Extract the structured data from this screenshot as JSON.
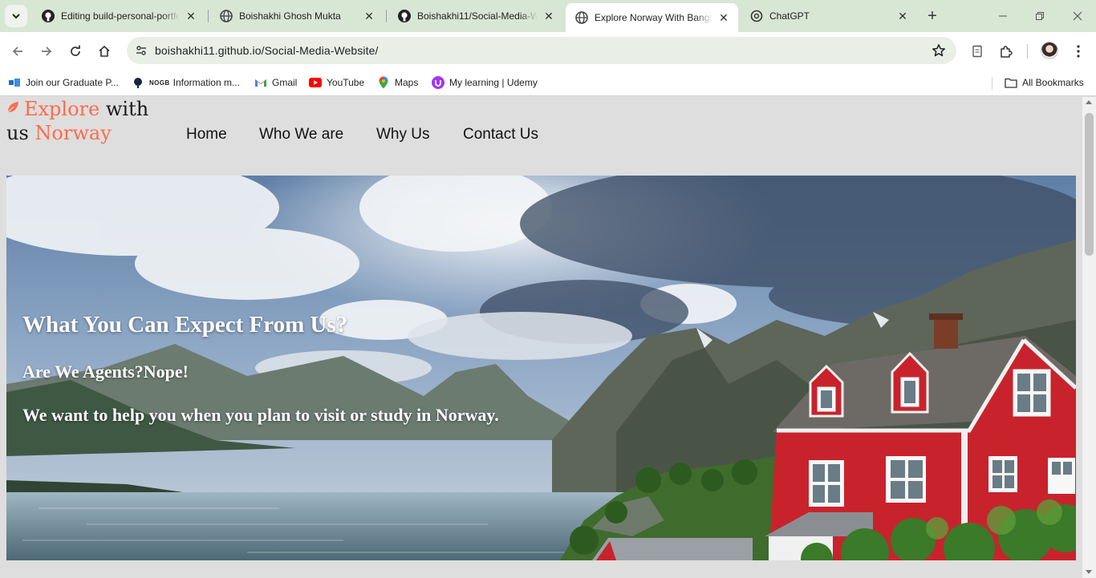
{
  "browser": {
    "tabs": [
      {
        "title": "Editing build-personal-portfolio",
        "icon": "github-icon"
      },
      {
        "title": "Boishakhi Ghosh Mukta",
        "icon": "globe-icon"
      },
      {
        "title": "Boishakhi11/Social-Media-Website",
        "icon": "github-icon"
      },
      {
        "title": "Explore Norway With Bangladeshi",
        "icon": "globe-icon",
        "active": true
      },
      {
        "title": "ChatGPT",
        "icon": "chatgpt-icon"
      }
    ],
    "url": "boishakhi11.github.io/Social-Media-Website/",
    "bookmarks": [
      {
        "label": "Join our Graduate P...",
        "icon": "microsoft-icon"
      },
      {
        "label": "Information m...",
        "prefix": "NOGB",
        "icon": "nogb-icon"
      },
      {
        "label": "Gmail",
        "icon": "gmail-icon"
      },
      {
        "label": "YouTube",
        "icon": "youtube-icon"
      },
      {
        "label": "Maps",
        "icon": "maps-icon"
      },
      {
        "label": "My learning | Udemy",
        "icon": "udemy-icon"
      }
    ],
    "all_bookmarks": "All Bookmarks"
  },
  "site": {
    "logo": {
      "word1": "Explore",
      "word2": "with",
      "word3": "us",
      "word4": "Norway"
    },
    "nav": [
      "Home",
      "Who We are",
      "Why Us",
      "Contact Us"
    ],
    "hero": {
      "heading": "What You Can Expect From Us?",
      "subheading": "Are We Agents?Nope!",
      "text": "We want to help you when you plan to visit or study in Norway."
    }
  },
  "colors": {
    "accent": "#ff6b4e",
    "house": "#c8232c",
    "chrome": "#d8e6d4"
  }
}
